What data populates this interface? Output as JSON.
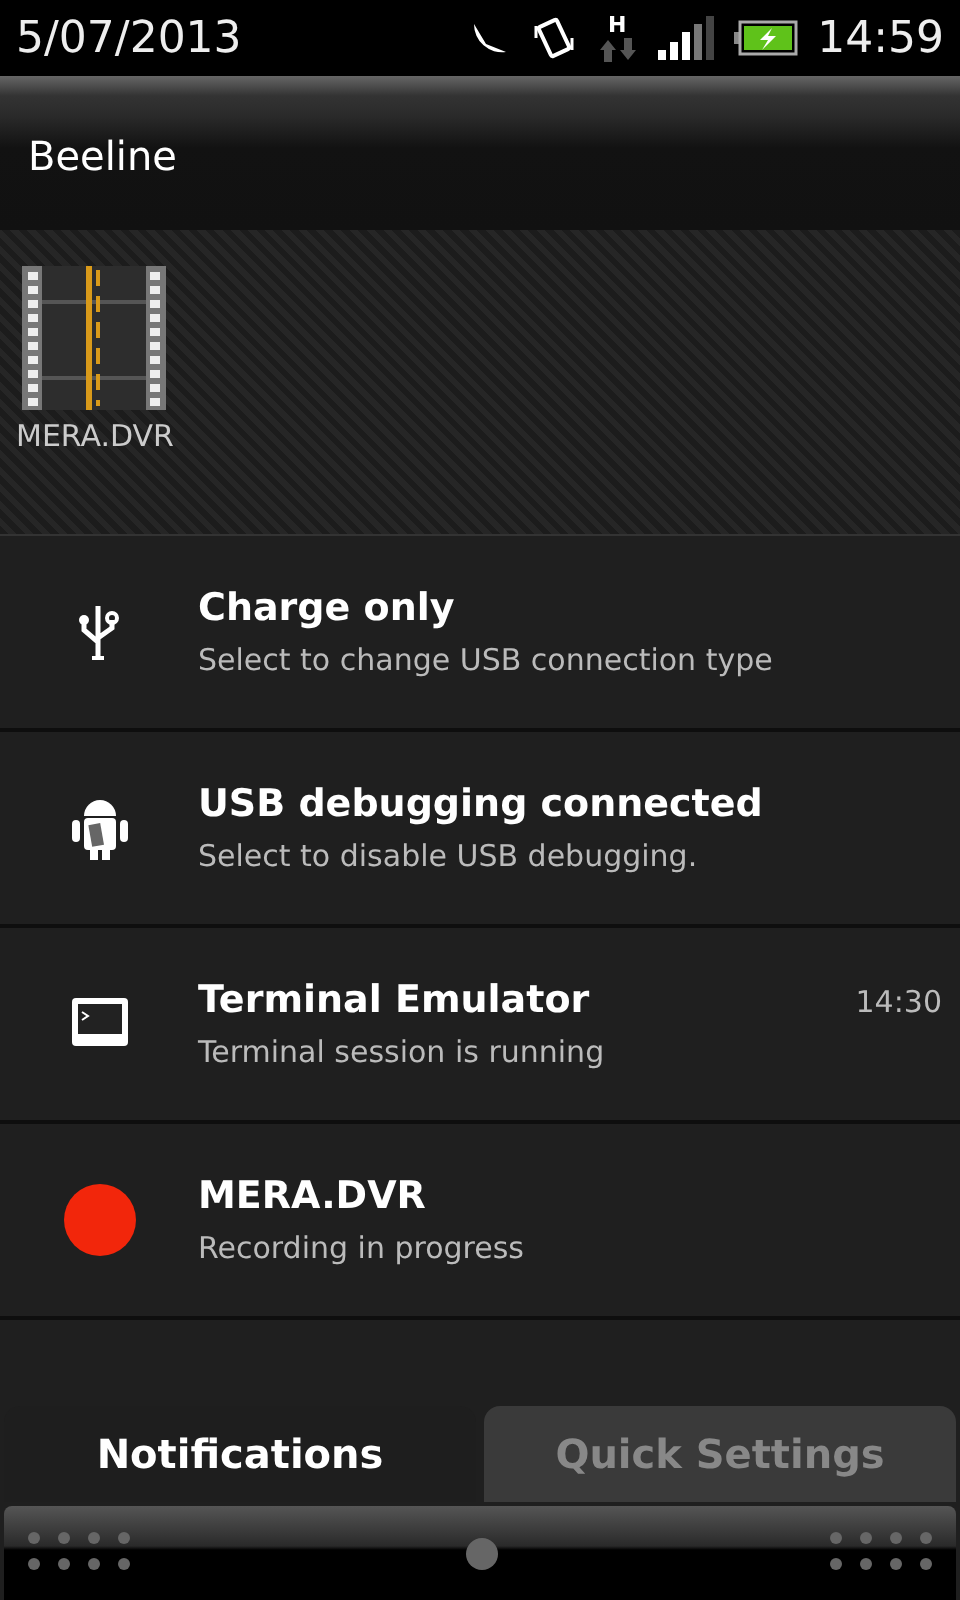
{
  "status_bar": {
    "date": "5/07/2013",
    "network": "H",
    "time": "14:59"
  },
  "carrier": {
    "name": "Beeline"
  },
  "running_apps": [
    {
      "label": "MERA.DVR"
    }
  ],
  "notifications": [
    {
      "kind": "usb",
      "title": "Charge only",
      "text": "Select to change USB connection type"
    },
    {
      "kind": "android",
      "title": "USB debugging connected",
      "text": "Select to disable USB debugging."
    },
    {
      "kind": "terminal",
      "title": "Terminal Emulator",
      "text": "Terminal session is running",
      "time": "14:30"
    },
    {
      "kind": "record",
      "title": "MERA.DVR",
      "text": "Recording in progress"
    }
  ],
  "tabs": [
    {
      "label": "Notifications",
      "selected": true
    },
    {
      "label": "Quick Settings",
      "selected": false
    }
  ]
}
